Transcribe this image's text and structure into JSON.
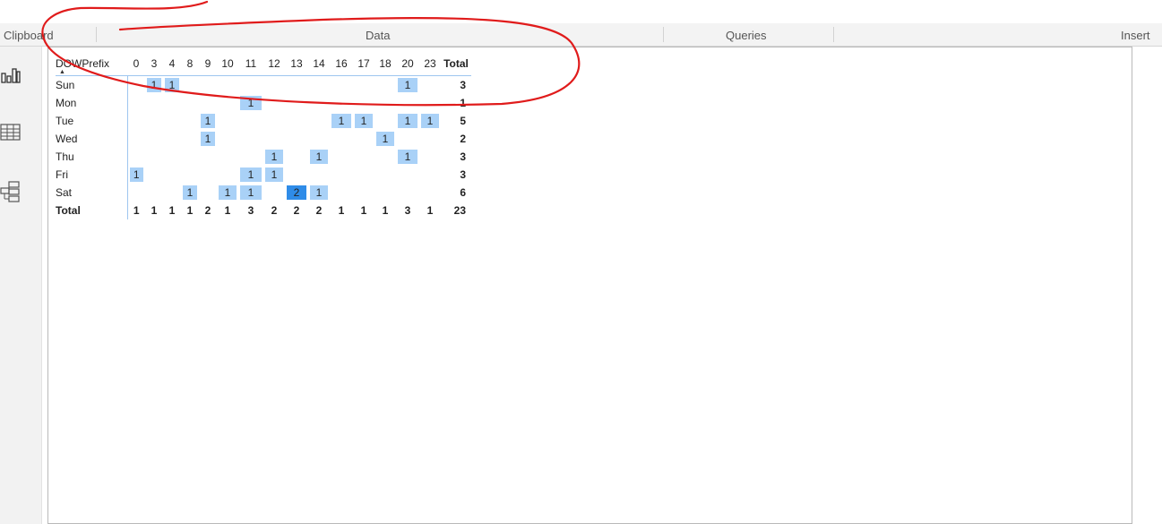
{
  "ribbon": {
    "groups": [
      "Clipboard",
      "Data",
      "Queries",
      "Insert"
    ]
  },
  "rail": {
    "icons": [
      "report-view-icon",
      "data-view-icon",
      "model-view-icon"
    ]
  },
  "matrix": {
    "row_header": "DOWPrefix",
    "columns": [
      "0",
      "3",
      "4",
      "8",
      "9",
      "10",
      "11",
      "12",
      "13",
      "14",
      "16",
      "17",
      "18",
      "20",
      "23"
    ],
    "total_label": "Total",
    "rows": [
      {
        "label": "Sun",
        "values": [
          "",
          "1",
          "1",
          "",
          "",
          "",
          "",
          "",
          "",
          "",
          "",
          "",
          "",
          "1",
          ""
        ],
        "total": "3"
      },
      {
        "label": "Mon",
        "values": [
          "",
          "",
          "",
          "",
          "",
          "",
          "1",
          "",
          "",
          "",
          "",
          "",
          "",
          "",
          ""
        ],
        "total": "1"
      },
      {
        "label": "Tue",
        "values": [
          "",
          "",
          "",
          "",
          "1",
          "",
          "",
          "",
          "",
          "",
          "1",
          "1",
          "",
          "1",
          "1"
        ],
        "total": "5"
      },
      {
        "label": "Wed",
        "values": [
          "",
          "",
          "",
          "",
          "1",
          "",
          "",
          "",
          "",
          "",
          "",
          "",
          "1",
          "",
          ""
        ],
        "total": "2"
      },
      {
        "label": "Thu",
        "values": [
          "",
          "",
          "",
          "",
          "",
          "",
          "",
          "1",
          "",
          "1",
          "",
          "",
          "",
          "1",
          ""
        ],
        "total": "3"
      },
      {
        "label": "Fri",
        "values": [
          "1",
          "",
          "",
          "",
          "",
          "",
          "1",
          "1",
          "",
          "",
          "",
          "",
          "",
          "",
          ""
        ],
        "total": "3"
      },
      {
        "label": "Sat",
        "values": [
          "",
          "",
          "",
          "1",
          "",
          "1",
          "1",
          "",
          "2",
          "1",
          "",
          "",
          "",
          "",
          ""
        ],
        "total": "6"
      }
    ],
    "column_totals": [
      "1",
      "1",
      "1",
      "1",
      "2",
      "1",
      "3",
      "2",
      "2",
      "2",
      "1",
      "1",
      "1",
      "3",
      "1"
    ],
    "grand_total": "23",
    "colors": {
      "level1": "#a9d1f7",
      "level2": "#2f8ce8",
      "header_line": "#9ec6ef"
    }
  },
  "annotation": {
    "color": "#e01b1b"
  }
}
